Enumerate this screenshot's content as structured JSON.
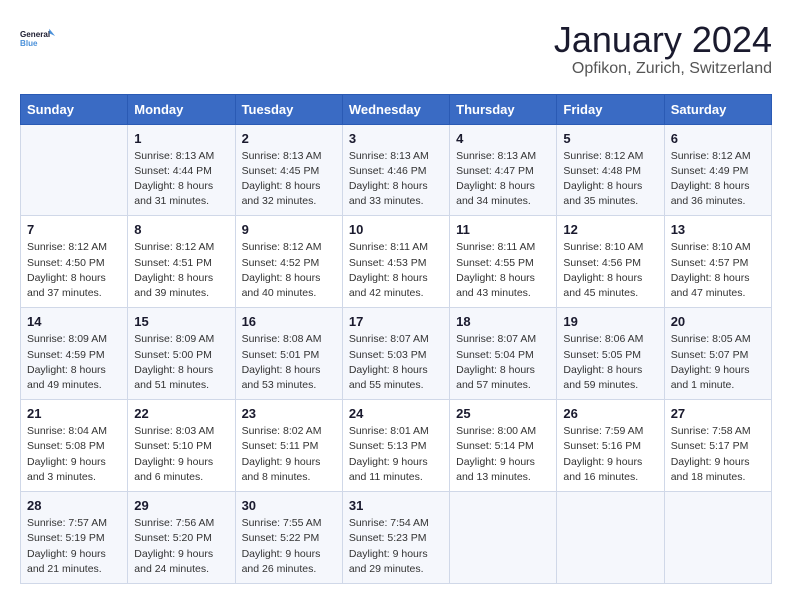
{
  "header": {
    "logo_line1": "General",
    "logo_line2": "Blue",
    "title": "January 2024",
    "subtitle": "Opfikon, Zurich, Switzerland"
  },
  "weekdays": [
    "Sunday",
    "Monday",
    "Tuesday",
    "Wednesday",
    "Thursday",
    "Friday",
    "Saturday"
  ],
  "weeks": [
    [
      {
        "day": "",
        "info": ""
      },
      {
        "day": "1",
        "info": "Sunrise: 8:13 AM\nSunset: 4:44 PM\nDaylight: 8 hours\nand 31 minutes."
      },
      {
        "day": "2",
        "info": "Sunrise: 8:13 AM\nSunset: 4:45 PM\nDaylight: 8 hours\nand 32 minutes."
      },
      {
        "day": "3",
        "info": "Sunrise: 8:13 AM\nSunset: 4:46 PM\nDaylight: 8 hours\nand 33 minutes."
      },
      {
        "day": "4",
        "info": "Sunrise: 8:13 AM\nSunset: 4:47 PM\nDaylight: 8 hours\nand 34 minutes."
      },
      {
        "day": "5",
        "info": "Sunrise: 8:12 AM\nSunset: 4:48 PM\nDaylight: 8 hours\nand 35 minutes."
      },
      {
        "day": "6",
        "info": "Sunrise: 8:12 AM\nSunset: 4:49 PM\nDaylight: 8 hours\nand 36 minutes."
      }
    ],
    [
      {
        "day": "7",
        "info": "Sunrise: 8:12 AM\nSunset: 4:50 PM\nDaylight: 8 hours\nand 37 minutes."
      },
      {
        "day": "8",
        "info": "Sunrise: 8:12 AM\nSunset: 4:51 PM\nDaylight: 8 hours\nand 39 minutes."
      },
      {
        "day": "9",
        "info": "Sunrise: 8:12 AM\nSunset: 4:52 PM\nDaylight: 8 hours\nand 40 minutes."
      },
      {
        "day": "10",
        "info": "Sunrise: 8:11 AM\nSunset: 4:53 PM\nDaylight: 8 hours\nand 42 minutes."
      },
      {
        "day": "11",
        "info": "Sunrise: 8:11 AM\nSunset: 4:55 PM\nDaylight: 8 hours\nand 43 minutes."
      },
      {
        "day": "12",
        "info": "Sunrise: 8:10 AM\nSunset: 4:56 PM\nDaylight: 8 hours\nand 45 minutes."
      },
      {
        "day": "13",
        "info": "Sunrise: 8:10 AM\nSunset: 4:57 PM\nDaylight: 8 hours\nand 47 minutes."
      }
    ],
    [
      {
        "day": "14",
        "info": "Sunrise: 8:09 AM\nSunset: 4:59 PM\nDaylight: 8 hours\nand 49 minutes."
      },
      {
        "day": "15",
        "info": "Sunrise: 8:09 AM\nSunset: 5:00 PM\nDaylight: 8 hours\nand 51 minutes."
      },
      {
        "day": "16",
        "info": "Sunrise: 8:08 AM\nSunset: 5:01 PM\nDaylight: 8 hours\nand 53 minutes."
      },
      {
        "day": "17",
        "info": "Sunrise: 8:07 AM\nSunset: 5:03 PM\nDaylight: 8 hours\nand 55 minutes."
      },
      {
        "day": "18",
        "info": "Sunrise: 8:07 AM\nSunset: 5:04 PM\nDaylight: 8 hours\nand 57 minutes."
      },
      {
        "day": "19",
        "info": "Sunrise: 8:06 AM\nSunset: 5:05 PM\nDaylight: 8 hours\nand 59 minutes."
      },
      {
        "day": "20",
        "info": "Sunrise: 8:05 AM\nSunset: 5:07 PM\nDaylight: 9 hours\nand 1 minute."
      }
    ],
    [
      {
        "day": "21",
        "info": "Sunrise: 8:04 AM\nSunset: 5:08 PM\nDaylight: 9 hours\nand 3 minutes."
      },
      {
        "day": "22",
        "info": "Sunrise: 8:03 AM\nSunset: 5:10 PM\nDaylight: 9 hours\nand 6 minutes."
      },
      {
        "day": "23",
        "info": "Sunrise: 8:02 AM\nSunset: 5:11 PM\nDaylight: 9 hours\nand 8 minutes."
      },
      {
        "day": "24",
        "info": "Sunrise: 8:01 AM\nSunset: 5:13 PM\nDaylight: 9 hours\nand 11 minutes."
      },
      {
        "day": "25",
        "info": "Sunrise: 8:00 AM\nSunset: 5:14 PM\nDaylight: 9 hours\nand 13 minutes."
      },
      {
        "day": "26",
        "info": "Sunrise: 7:59 AM\nSunset: 5:16 PM\nDaylight: 9 hours\nand 16 minutes."
      },
      {
        "day": "27",
        "info": "Sunrise: 7:58 AM\nSunset: 5:17 PM\nDaylight: 9 hours\nand 18 minutes."
      }
    ],
    [
      {
        "day": "28",
        "info": "Sunrise: 7:57 AM\nSunset: 5:19 PM\nDaylight: 9 hours\nand 21 minutes."
      },
      {
        "day": "29",
        "info": "Sunrise: 7:56 AM\nSunset: 5:20 PM\nDaylight: 9 hours\nand 24 minutes."
      },
      {
        "day": "30",
        "info": "Sunrise: 7:55 AM\nSunset: 5:22 PM\nDaylight: 9 hours\nand 26 minutes."
      },
      {
        "day": "31",
        "info": "Sunrise: 7:54 AM\nSunset: 5:23 PM\nDaylight: 9 hours\nand 29 minutes."
      },
      {
        "day": "",
        "info": ""
      },
      {
        "day": "",
        "info": ""
      },
      {
        "day": "",
        "info": ""
      }
    ]
  ]
}
